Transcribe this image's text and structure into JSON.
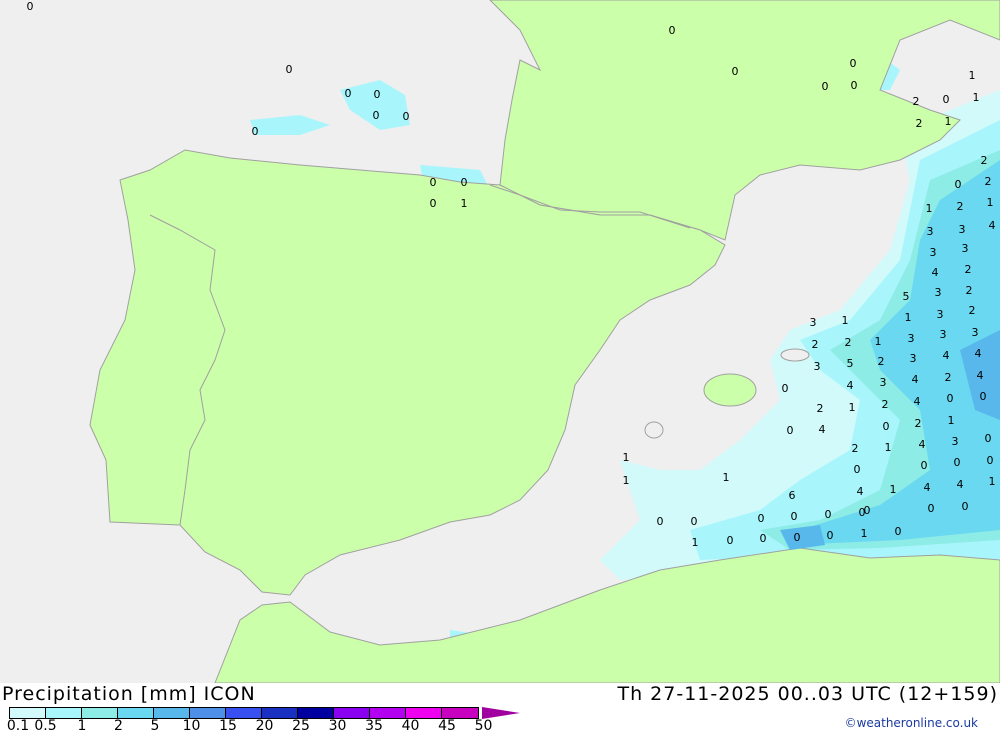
{
  "title": "Precipitation [mm] ICON",
  "valid_time": "Th 27-11-2025 00..03 UTC (12+159)",
  "credit": "©weatheronline.co.uk",
  "colors": {
    "sea": "#efefef",
    "land": "#ccffaa",
    "border": "#a0a0a0",
    "precip_0_1": "#d2fafa",
    "precip_0_5": "#a8f6fc",
    "precip_1": "#8eece6",
    "precip_2": "#6ad8f0",
    "precip_5": "#58b8ec"
  },
  "legend": {
    "ticks": [
      "0.1",
      "0.5",
      "1",
      "2",
      "5",
      "10",
      "15",
      "20",
      "25",
      "30",
      "35",
      "40",
      "45",
      "50"
    ],
    "colors": [
      "#d2fafa",
      "#a8f6fc",
      "#8eece6",
      "#6ad8f0",
      "#58b8ec",
      "#4e90e8",
      "#3850f0",
      "#1a30c0",
      "#0000a0",
      "#8a00f0",
      "#b400f0",
      "#f000f0",
      "#c800c0"
    ],
    "overflow_color": "#a000a0"
  },
  "map_labels": [
    "0",
    "0",
    "0",
    "0",
    "0",
    "0",
    "0",
    "0",
    "0",
    "0",
    "0",
    "0",
    "0",
    "0",
    "0",
    "1",
    "2",
    "0",
    "1",
    "1",
    "2",
    "1",
    "2",
    "0",
    "2",
    "1",
    "2",
    "1",
    "3",
    "3",
    "4",
    "3",
    "3",
    "4",
    "2",
    "5",
    "3",
    "2",
    "3",
    "1",
    "1",
    "3",
    "2",
    "2",
    "2",
    "1",
    "3",
    "3",
    "3",
    "3",
    "5",
    "2",
    "3",
    "4",
    "4",
    "4",
    "3",
    "4",
    "2",
    "4",
    "1",
    "2",
    "4",
    "0",
    "0",
    "0",
    "2",
    "0",
    "2",
    "1",
    "0",
    "4",
    "2",
    "1",
    "4",
    "3",
    "0",
    "0",
    "0",
    "0",
    "0",
    "1",
    "1",
    "1",
    "6",
    "4",
    "1",
    "4",
    "4",
    "1",
    "0",
    "0",
    "0",
    "0",
    "0",
    "0",
    "0",
    "1",
    "0",
    "0",
    "0",
    "0",
    "1",
    "0",
    "0",
    "0"
  ]
}
